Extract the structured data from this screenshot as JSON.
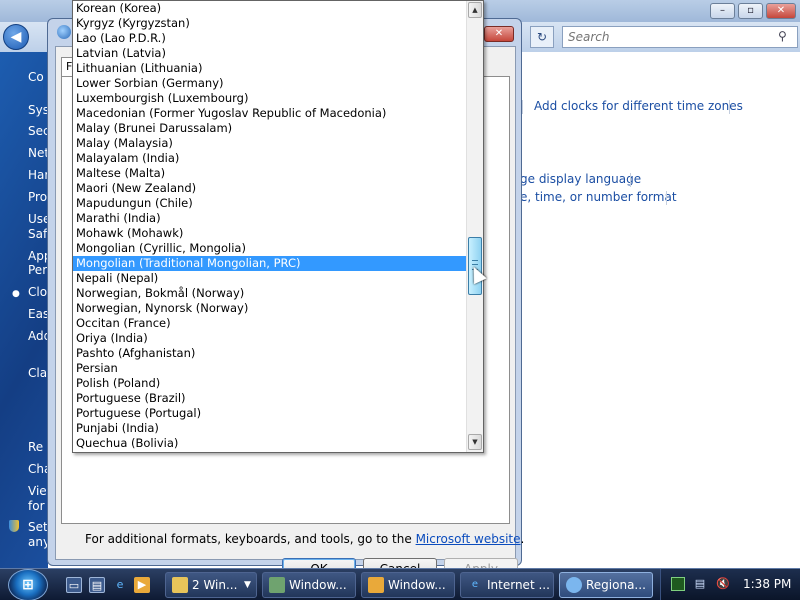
{
  "control_panel": {
    "search_placeholder": "Search",
    "sidebar_items": [
      "Co",
      "Sys",
      "Sec",
      "Net",
      "Har",
      "Pro",
      "Use",
      "Saf",
      "App",
      "Per",
      "Clo",
      "Eas",
      "Add",
      "Cla",
      "Re",
      "Cha",
      "Vie",
      "for",
      "Set",
      "any"
    ],
    "links": {
      "add_clocks": "Add clocks for different time zones",
      "display_language": "ge display language",
      "time_format": "e, time, or number format"
    }
  },
  "dialog": {
    "tab_label": "F",
    "info_text": "For additional formats, keyboards, and tools, go to the ",
    "info_link": "Microsoft website",
    "info_end": ".",
    "buttons": {
      "ok": "OK",
      "cancel": "Cancel",
      "apply": "Apply"
    }
  },
  "language_list": {
    "items": [
      "Korean (Korea)",
      "Kyrgyz (Kyrgyzstan)",
      "Lao (Lao P.D.R.)",
      "Latvian (Latvia)",
      "Lithuanian (Lithuania)",
      "Lower Sorbian (Germany)",
      "Luxembourgish (Luxembourg)",
      "Macedonian (Former Yugoslav Republic of Macedonia)",
      "Malay (Brunei Darussalam)",
      "Malay (Malaysia)",
      "Malayalam (India)",
      "Maltese (Malta)",
      "Maori (New Zealand)",
      "Mapudungun (Chile)",
      "Marathi (India)",
      "Mohawk (Mohawk)",
      "Mongolian (Cyrillic, Mongolia)",
      "Mongolian (Traditional Mongolian, PRC)",
      "Nepali (Nepal)",
      "Norwegian, Bokmål (Norway)",
      "Norwegian, Nynorsk (Norway)",
      "Occitan (France)",
      "Oriya (India)",
      "Pashto (Afghanistan)",
      "Persian",
      "Polish (Poland)",
      "Portuguese (Brazil)",
      "Portuguese (Portugal)",
      "Punjabi (India)",
      "Quechua (Bolivia)"
    ],
    "selected": "Mongolian (Traditional Mongolian, PRC)"
  },
  "taskbar": {
    "buttons": [
      "2 Win...",
      "Window...",
      "Window...",
      "Internet ...",
      "Regiona..."
    ],
    "clock": "1:38 PM"
  },
  "colors": {
    "selection": "#3399ff",
    "link": "#1b4ea3",
    "taskbar": "#1a2a4a"
  }
}
